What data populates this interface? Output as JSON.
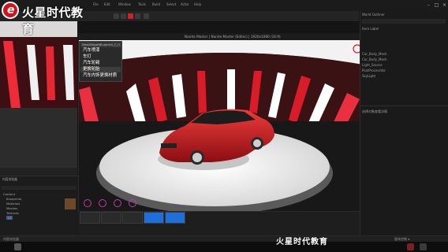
{
  "brand": {
    "logo_glyph": "e",
    "logo_text": "火星时代教育",
    "watermark": "火星时代教育"
  },
  "menu": [
    "File",
    "Edit",
    "Window",
    "Tools",
    "Build",
    "Select",
    "Actor",
    "Help"
  ],
  "viewport": {
    "title": "Nanite Master | Nanite Master (Editor) | 1920x1080 (16:9)",
    "context_menu": {
      "header": "NewWidgetBlueprint_C_0",
      "items": [
        "汽车喷漆",
        "车灯",
        "汽车轮毂",
        "更换轮胎",
        "汽车内饰更换材质"
      ]
    }
  },
  "outliner": {
    "rows": [
      "World Outliner",
      "Item Label",
      "Car_Body_Mesh",
      "Car_Body_Mesh",
      "Light_Source",
      "PostProcessVol",
      "SkyLight"
    ],
    "details_title": "选择对象查看详情"
  },
  "content_browser": {
    "title": "内容浏览器",
    "tree": [
      "Content",
      "Blueprints",
      "Materials",
      "Meshes",
      "Textures",
      "UI"
    ],
    "thumb_labels": [
      "",
      "",
      "",
      "",
      "",
      "",
      "W_UI",
      "MainUI"
    ],
    "search_placeholder": "搜索"
  },
  "statusbar": {
    "left": "内容浏览器",
    "right": "版本控制 ▾"
  },
  "colors": {
    "accent": "#c8141c",
    "selection": "#1e6fd9",
    "menu_highlight": "#3d3d3d",
    "stage": "#ececec"
  }
}
